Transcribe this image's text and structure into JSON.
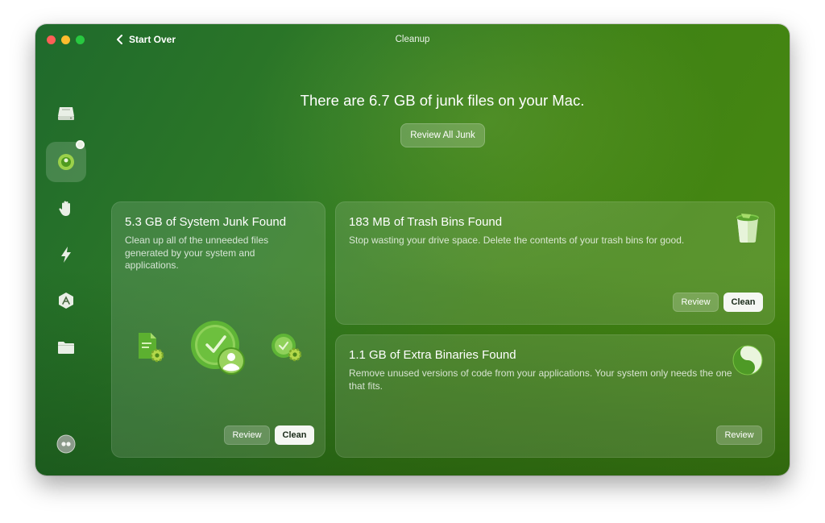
{
  "window": {
    "title": "Cleanup",
    "back_label": "Start Over"
  },
  "sidebar": {
    "items": [
      {
        "icon": "drive-icon"
      },
      {
        "icon": "cleanup-icon",
        "active": true
      },
      {
        "icon": "hand-icon"
      },
      {
        "icon": "lightning-icon"
      },
      {
        "icon": "app-store-icon"
      },
      {
        "icon": "folder-icon"
      }
    ],
    "bottom_icon": "assistant-icon"
  },
  "hero": {
    "headline": "There are 6.7 GB of junk files on your Mac.",
    "review_all_label": "Review All Junk"
  },
  "cards": {
    "system_junk": {
      "title": "5.3 GB of System Junk Found",
      "description": "Clean up all of the unneeded files generated by your system and applications.",
      "review_label": "Review",
      "clean_label": "Clean"
    },
    "trash_bins": {
      "title": "183 MB of Trash Bins Found",
      "description": "Stop wasting your drive space. Delete the contents of your trash bins for good.",
      "review_label": "Review",
      "clean_label": "Clean"
    },
    "extra_binaries": {
      "title": "1.1 GB of Extra Binaries Found",
      "description": "Remove unused versions of code from your applications. Your system only needs the one that fits.",
      "review_label": "Review"
    }
  },
  "colors": {
    "accent_green": "#3f8214",
    "traffic_red": "#fe5f57",
    "traffic_yellow": "#febc2e",
    "traffic_green": "#28c840"
  }
}
